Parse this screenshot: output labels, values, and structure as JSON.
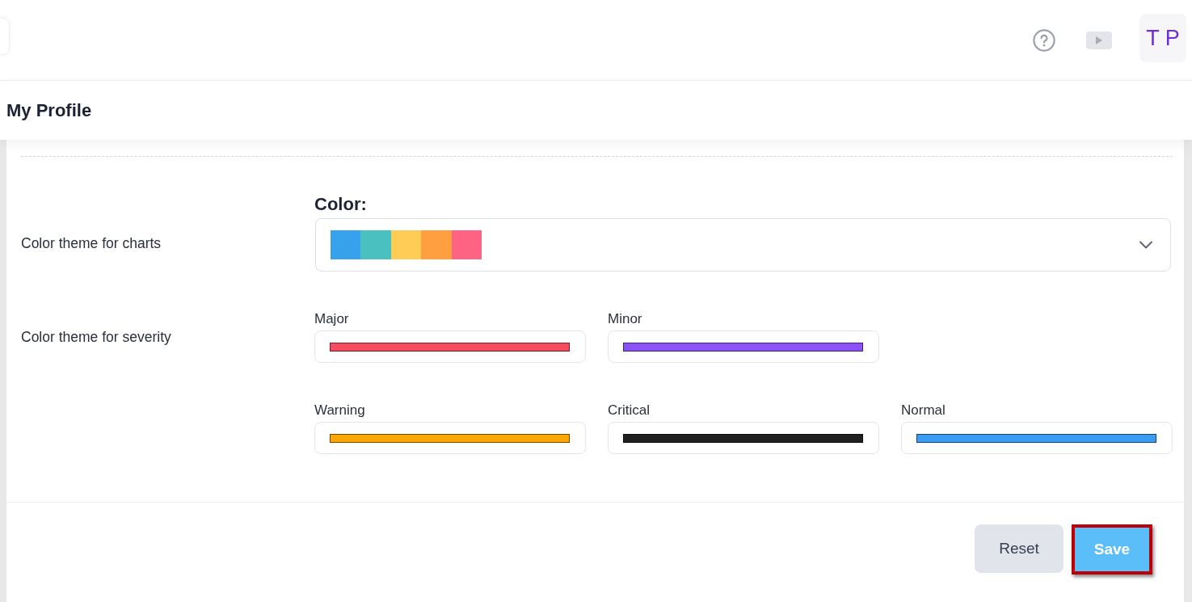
{
  "header": {
    "avatar": "T P"
  },
  "page_title": "My Profile",
  "settings": [
    {
      "kind": "palette",
      "label": "Color theme for charts",
      "heading": "Color:",
      "palette": [
        {
          "color": "#36a2eb"
        },
        {
          "color": "#4bc0c0"
        },
        {
          "color": "#ffcd56"
        },
        {
          "color": "#ff9f40"
        },
        {
          "color": "#ff6384"
        }
      ]
    },
    {
      "kind": "severity",
      "label": "Color theme for severity",
      "rows": [
        [
          {
            "label": "Major",
            "color": "#f54c62"
          },
          {
            "label": "Minor",
            "color": "#8a52f7"
          }
        ],
        [
          {
            "label": "Warning",
            "color": "#ffa600"
          },
          {
            "label": "Critical",
            "color": "#202020"
          },
          {
            "label": "Normal",
            "color": "#3b9cf3"
          }
        ]
      ]
    }
  ],
  "buttons": [
    {
      "label": "Reset",
      "kind": "secondary",
      "highlighted": false
    },
    {
      "label": "Save",
      "kind": "primary",
      "highlighted": true
    }
  ]
}
